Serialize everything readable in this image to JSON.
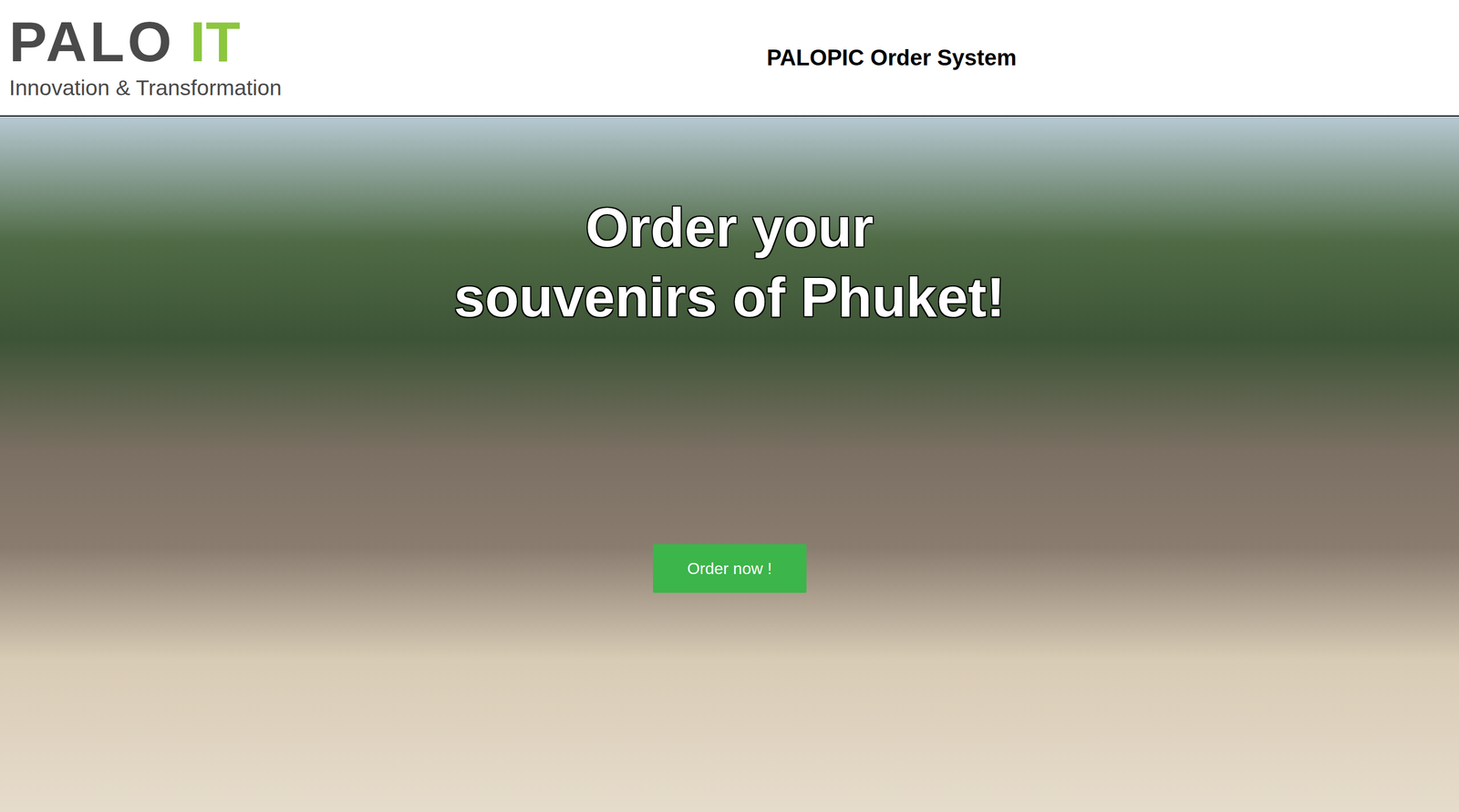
{
  "header": {
    "logo": {
      "mark": "PALO",
      "accent": "IT",
      "tagline": "Innovation & Transformation"
    },
    "title": "PALOPIC Order System"
  },
  "hero": {
    "heading": [
      "Order your",
      "souvenirs of Phuket!"
    ],
    "button": "Order now !"
  }
}
